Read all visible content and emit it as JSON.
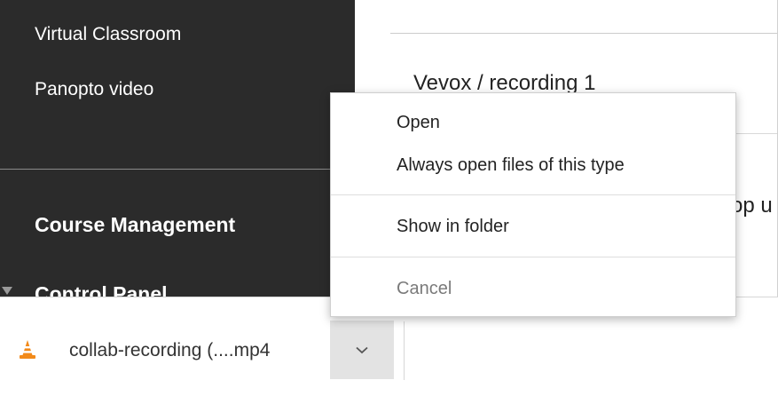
{
  "sidebar": {
    "items": [
      {
        "label": "Virtual Classroom"
      },
      {
        "label": "Panopto video"
      }
    ],
    "headings": {
      "course_management": "Course Management",
      "control_panel": "Control Panel"
    }
  },
  "content": {
    "title": "Vevox / recording 1",
    "partial_text": "op u"
  },
  "download": {
    "file_name": "collab-recording (....mp4",
    "file_icon": "vlc-icon",
    "dropdown_icon": "chevron-down-icon"
  },
  "context_menu": {
    "items": [
      {
        "label": "Open",
        "enabled": true
      },
      {
        "label": "Always open files of this type",
        "enabled": true
      },
      {
        "label": "Show in folder",
        "enabled": true
      },
      {
        "label": "Cancel",
        "enabled": false
      }
    ]
  },
  "colors": {
    "sidebar_bg": "#2b2b2b",
    "vlc_orange": "#f28a1a",
    "dropdown_bg": "#e3e3e3",
    "disabled_text": "#7a7a7a"
  }
}
